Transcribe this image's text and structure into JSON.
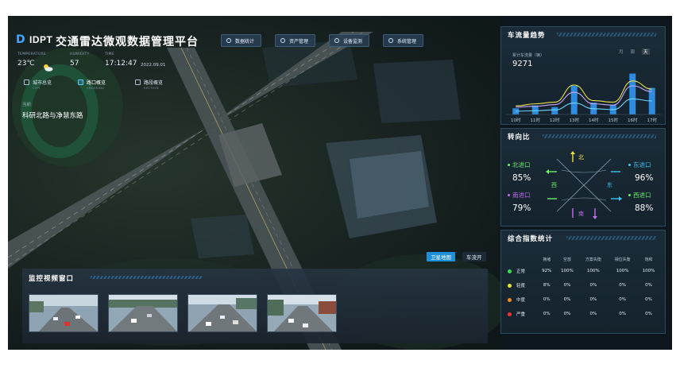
{
  "app": {
    "logo_text": "IDPT",
    "title": "交通雷达微观数据管理平台"
  },
  "nav": [
    {
      "label": "数据统计",
      "icon": "chart-icon"
    },
    {
      "label": "资产管理",
      "icon": "asset-icon"
    },
    {
      "label": "设备监测",
      "icon": "device-icon"
    },
    {
      "label": "系统管理",
      "icon": "settings-icon"
    }
  ],
  "meta": {
    "temperature_label": "TEMPERATURE",
    "temperature": "23℃",
    "humidity_label": "HUMIDITY",
    "humidity": "57",
    "time_label": "TIME",
    "time": "17:12:47",
    "date": "2022.09.01",
    "weather_icon": "partly-cloudy-icon"
  },
  "tabs": [
    {
      "label": "城市总览",
      "sub": "CITY"
    },
    {
      "label": "路口概览",
      "sub": "CROSSING"
    },
    {
      "label": "路段概览",
      "sub": "SECTION"
    }
  ],
  "current": {
    "label": "当前",
    "road": "科研北路与净慧东路"
  },
  "map_buttons": {
    "satellite": "卫星地图",
    "traffic": "车流开"
  },
  "video": {
    "title": "监控视频窗口",
    "camera_count": 4
  },
  "flow": {
    "title": "车流量趋势",
    "subtitle": "累计车流量（辆）",
    "total": "9271",
    "periods": [
      "月",
      "周",
      "天"
    ],
    "active_period": "天"
  },
  "turn": {
    "title": "转向比",
    "north": "北",
    "south": "南",
    "east": "东",
    "west": "西",
    "entries": [
      {
        "name": "北进口",
        "value": "85%",
        "color": "#6cf06c"
      },
      {
        "name": "南进口",
        "value": "79%",
        "color": "#c56cf0"
      },
      {
        "name": "东进口",
        "value": "96%",
        "color": "#39c6f5"
      },
      {
        "name": "西进口",
        "value": "88%",
        "color": "#6cf06c"
      }
    ]
  },
  "index": {
    "title": "综合指数统计",
    "columns": [
      "",
      "拥堵",
      "空放",
      "方案失衡",
      "相位失衡",
      "饱和"
    ],
    "rows": [
      {
        "level": "正常",
        "color": "#3ed85a",
        "values": [
          "92%",
          "100%",
          "100%",
          "100%",
          "100%"
        ]
      },
      {
        "level": "轻度",
        "color": "#e7e53a",
        "values": [
          "8%",
          "0%",
          "0%",
          "0%",
          "0%"
        ]
      },
      {
        "level": "中度",
        "color": "#f08b2c",
        "values": [
          "0%",
          "0%",
          "0%",
          "0%",
          "0%"
        ]
      },
      {
        "level": "严重",
        "color": "#e83737",
        "values": [
          "0%",
          "0%",
          "0%",
          "0%",
          "0%"
        ]
      }
    ]
  },
  "chart_data": {
    "type": "bar",
    "categories": [
      "10时",
      "11时",
      "12时",
      "13时",
      "14时",
      "15时",
      "16时",
      "17时"
    ],
    "series": [
      {
        "values": [
          150,
          220,
          180,
          700,
          290,
          240,
          1000,
          650
        ],
        "color": "#2f8be0"
      },
      {
        "values": [
          210,
          260,
          300,
          720,
          340,
          300,
          820,
          620
        ],
        "color": "#e8e04a",
        "style": "line"
      },
      {
        "values": [
          180,
          200,
          240,
          540,
          260,
          230,
          700,
          560
        ],
        "color": "#c8a8ff",
        "style": "line"
      },
      {
        "values": [
          80,
          90,
          110,
          280,
          140,
          120,
          380,
          330
        ],
        "color": "#6fd6ff",
        "style": "line"
      }
    ],
    "legend": "none",
    "grid": false
  }
}
